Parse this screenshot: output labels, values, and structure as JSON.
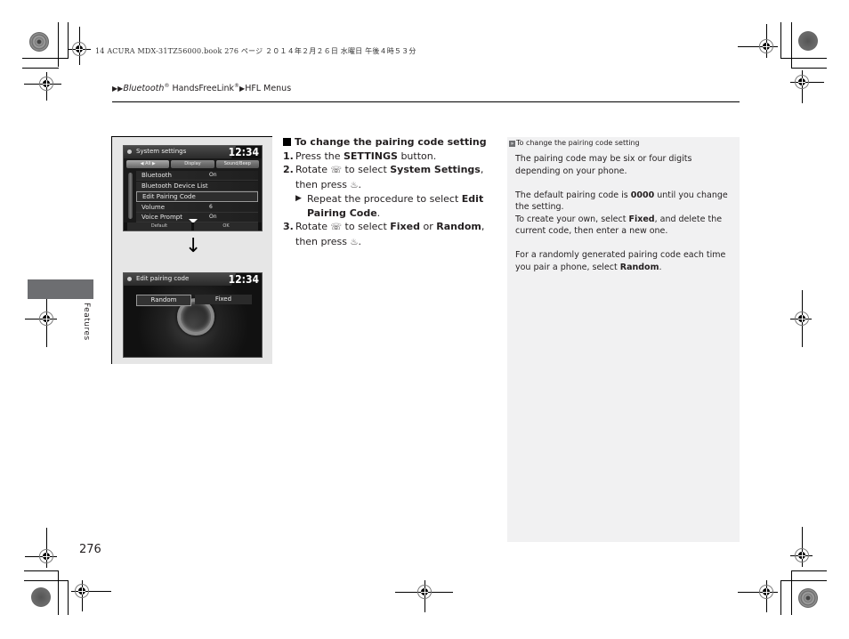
{
  "print_header": {
    "text": "14 ACURA MDX-31TZ56000.book  276 ページ  ２０１４年２月２６日  水曜日  午後４時５３分"
  },
  "breadcrumb": {
    "separator_icon": "double-triangle-right-icon",
    "part1_italic": "Bluetooth",
    "part1_reg": "®",
    "part2": " HandsFreeLink",
    "part2_reg": "®",
    "part3": "HFL Menus"
  },
  "side_tab": {
    "label": "Features"
  },
  "figure": {
    "screen1": {
      "title": "System settings",
      "clock": "12:34",
      "tabs": [
        "All",
        "Display",
        "Sound/Beep"
      ],
      "menu": [
        {
          "label": "Bluetooth",
          "value": "On"
        },
        {
          "label": "Bluetooth Device List",
          "value": ""
        },
        {
          "label": "Edit Pairing Code",
          "value": "",
          "selected": true
        },
        {
          "label": "Volume",
          "value": "6"
        },
        {
          "label": "Voice Prompt",
          "value": "On"
        }
      ],
      "bottom_buttons": [
        "Default",
        "OK"
      ]
    },
    "arrow": "↓",
    "screen2": {
      "title": "Edit pairing code",
      "clock": "12:34",
      "options": [
        "Random",
        "Fixed"
      ],
      "selected_option": "Random"
    }
  },
  "instructions": {
    "heading": "To change the pairing code setting",
    "steps": [
      {
        "num": "1.",
        "pre": "Press the ",
        "bold": "SETTINGS",
        "post": " button."
      },
      {
        "num": "2.",
        "pre": "Rotate ",
        "icon": "interface-dial-rotate-icon",
        "mid": " to select ",
        "bold": "System Settings",
        "post": ", then press ",
        "icon2": "interface-dial-press-icon",
        "end": "."
      },
      {
        "num": "3.",
        "pre": "Rotate ",
        "icon": "interface-dial-rotate-icon",
        "mid": " to select ",
        "bold": "Fixed",
        "or": " or ",
        "bold2": "Random",
        "post": ", then press ",
        "icon2": "interface-dial-press-icon",
        "end": "."
      }
    ],
    "substep": {
      "pre": "Repeat the procedure to select ",
      "bold": "Edit Pairing Code",
      "end": "."
    }
  },
  "sidebar": {
    "title": "To change the pairing code setting",
    "p1": "The pairing code may be six or four digits depending on your phone.",
    "p2_pre": "The default pairing code is ",
    "p2_bold": "0000",
    "p2_post": " until you change the setting.",
    "p2b_pre": "To create your own, select ",
    "p2b_bold": "Fixed",
    "p2b_post": ", and delete the current code, then enter a new one.",
    "p3_pre": "For a randomly generated pairing code each time you pair a phone, select ",
    "p3_bold": "Random",
    "p3_post": "."
  },
  "page_number": "276",
  "colors": {
    "sidebar_bg": "#f1f1f2",
    "side_tab_bg": "#6d6e71",
    "figure_bg": "#e6e6e6"
  }
}
